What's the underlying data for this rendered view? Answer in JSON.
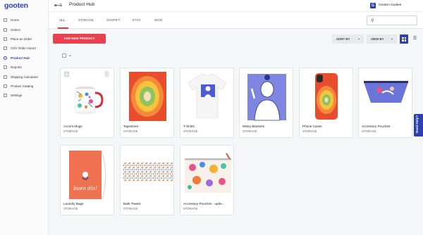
{
  "sidebar": {
    "logo": "gooten",
    "items": [
      {
        "label": "Home",
        "icon": "home-icon"
      },
      {
        "label": "Orders",
        "icon": "orders-icon"
      },
      {
        "label": "Place an Order",
        "icon": "cart-icon"
      },
      {
        "label": "CSV Order Import",
        "icon": "file-icon"
      },
      {
        "label": "Product Hub",
        "icon": "hub-icon",
        "active": true
      },
      {
        "label": "Reports",
        "icon": "chart-icon"
      },
      {
        "label": "Shipping Calculator",
        "icon": "calculator-icon"
      },
      {
        "label": "Product Catalog",
        "icon": "catalog-icon"
      },
      {
        "label": "Settings",
        "icon": "gear-icon"
      }
    ]
  },
  "header": {
    "title": "Product Hub",
    "guides_badge": "G",
    "guides_label": "Gooten Guides"
  },
  "tabs": [
    "ALL",
    "STORAGE",
    "SHOPIFY",
    "ETSY",
    "WOO"
  ],
  "active_tab": "ALL",
  "search": {
    "placeholder": ""
  },
  "toolbar": {
    "add_label": "ADD NEW PRODUCT",
    "sort_label": "SORT BY",
    "view_label": "VIEW BY"
  },
  "products": [
    {
      "title": "Accent Mugs",
      "source": "STORAGE"
    },
    {
      "title": "Tapestries -",
      "source": "STORAGE"
    },
    {
      "title": "T-Shirts",
      "source": "STORAGE"
    },
    {
      "title": "Minky Blankets",
      "source": "STORAGE"
    },
    {
      "title": "Phone Cases",
      "source": "STORAGE"
    },
    {
      "title": "Accessory Pouches",
      "source": "STORAGE"
    },
    {
      "title": "Laundry Bags",
      "source": "STORAGE"
    },
    {
      "title": "Bath Towels",
      "source": "STORAGE"
    },
    {
      "title": "Accessory Pouches - upde...",
      "source": "STORAGE"
    }
  ],
  "help": {
    "label": "Need Help?"
  },
  "colors": {
    "brand": "#2c3fb5",
    "accent": "#e8414f",
    "tab_indicator": "#e1323f"
  }
}
